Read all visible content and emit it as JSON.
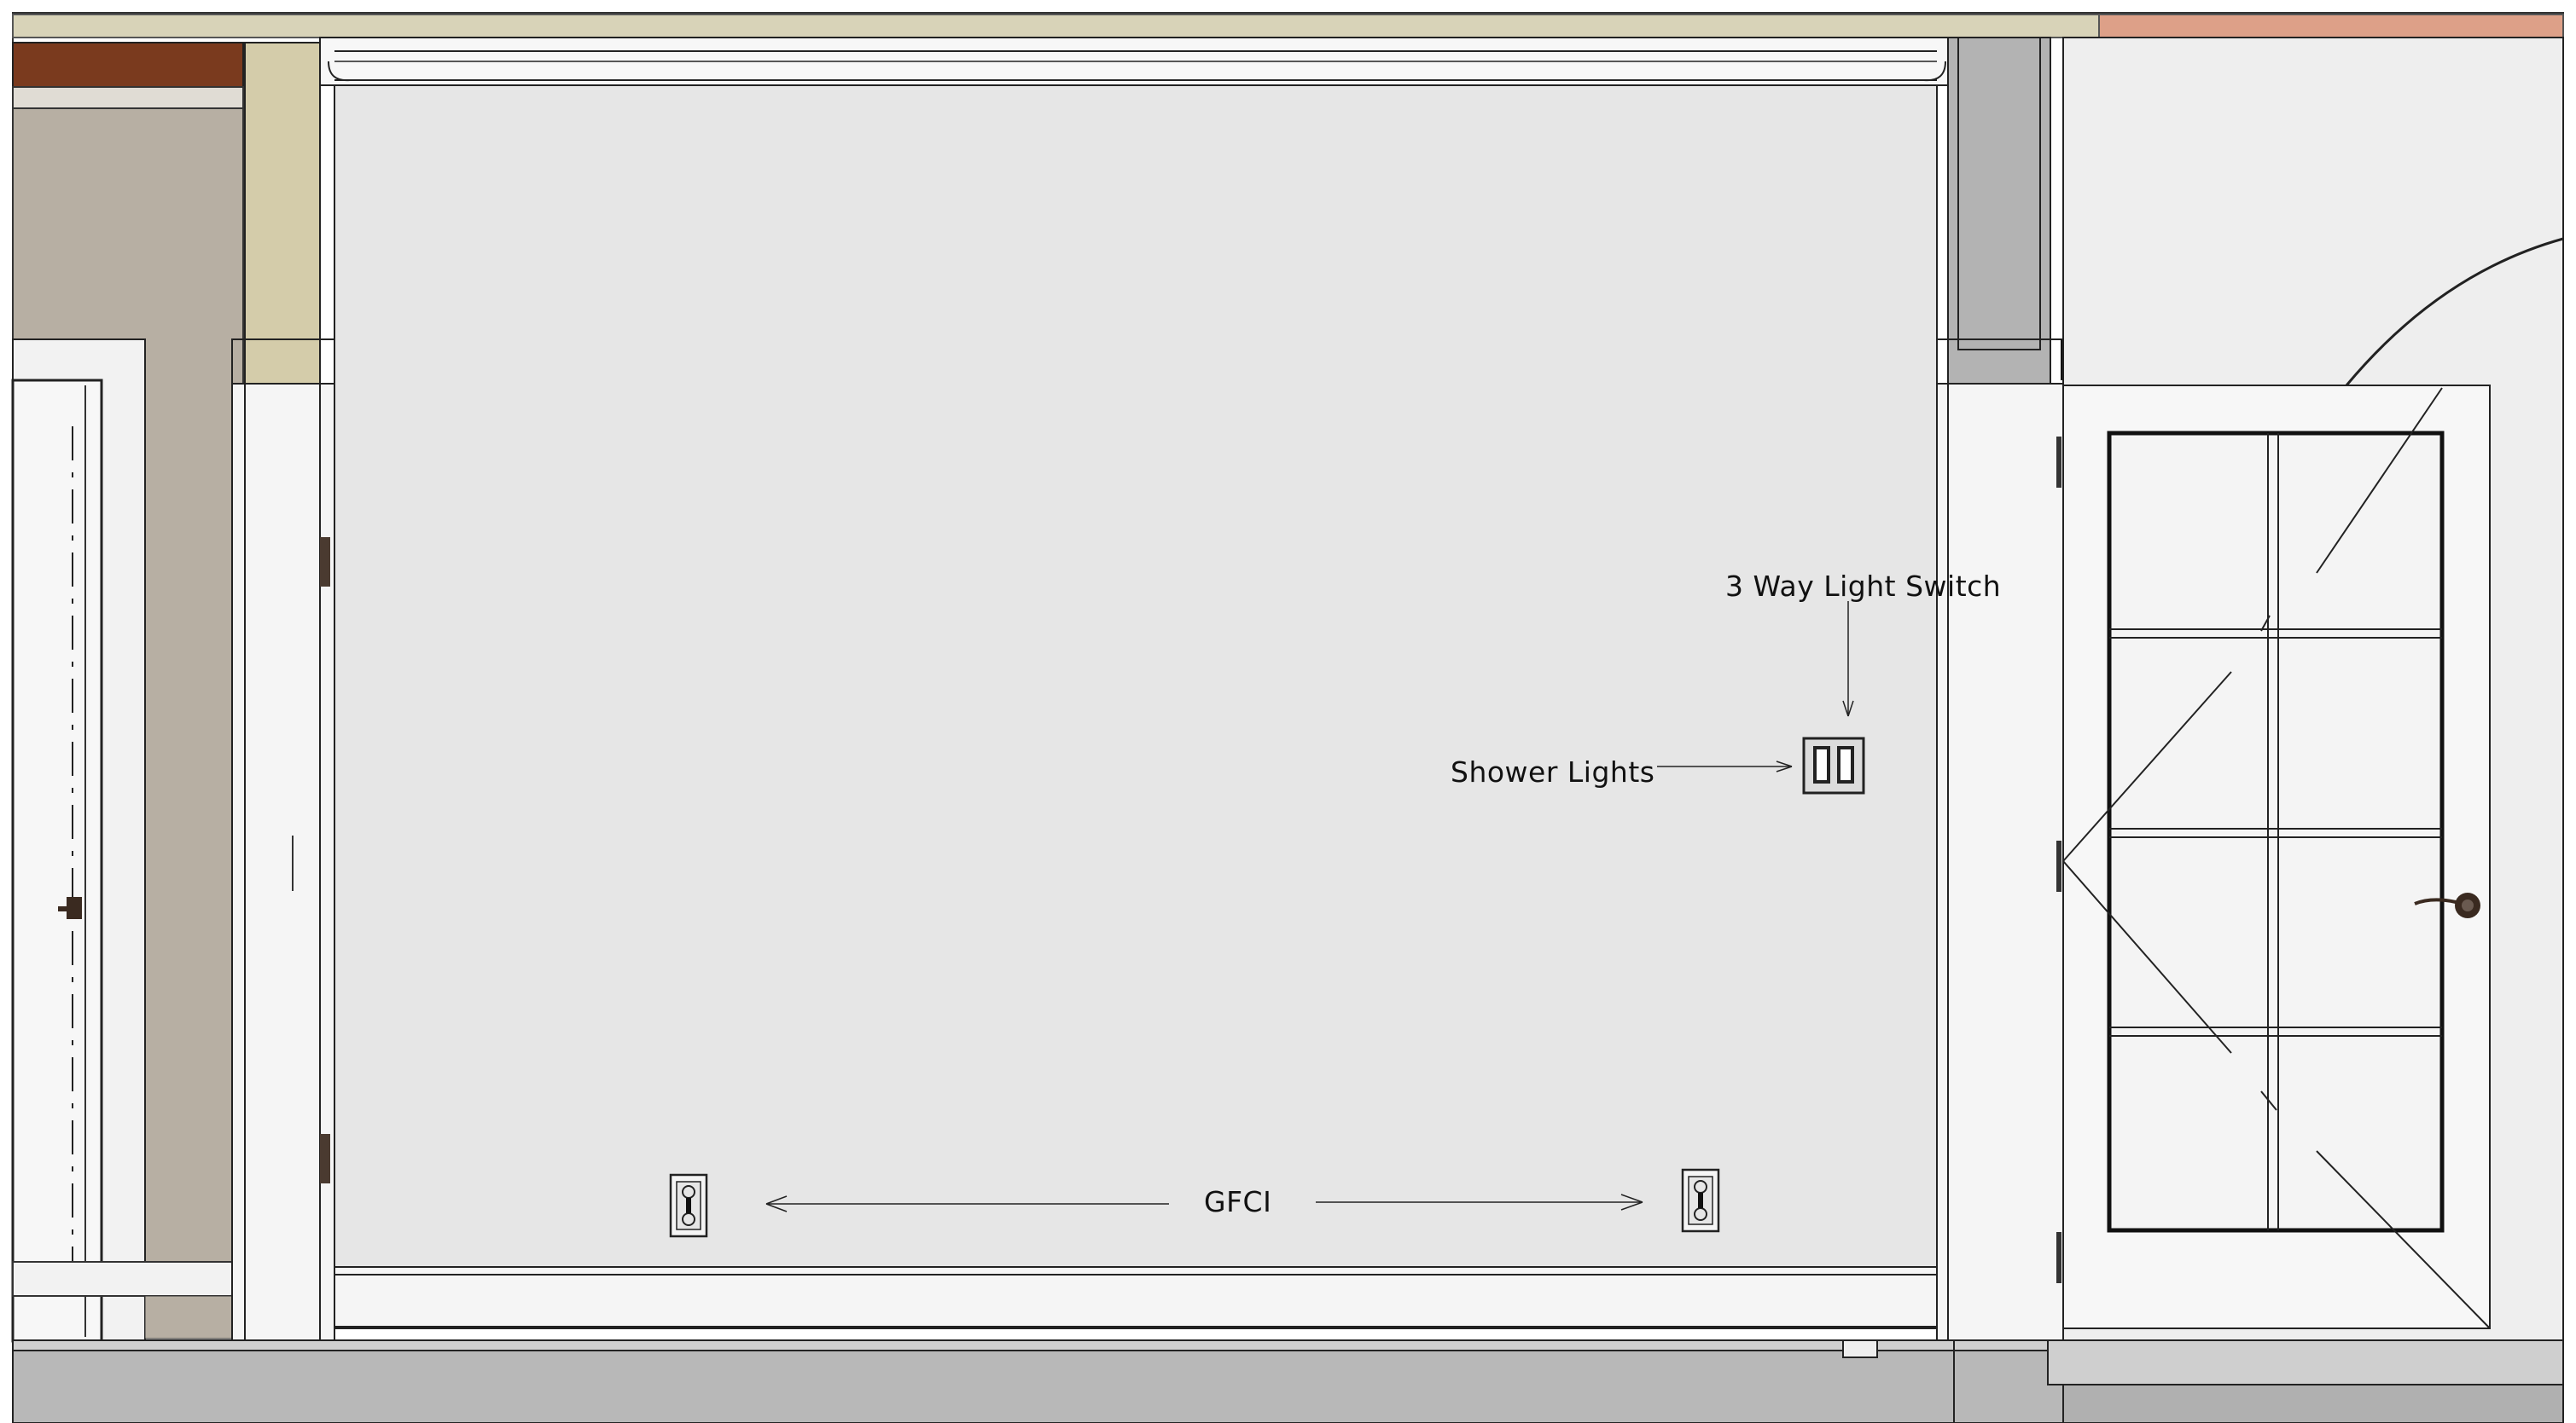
{
  "labels": {
    "switch_label": "3 Way Light Switch",
    "shower_label": "Shower Lights",
    "gfci_label": "GFCI"
  },
  "colors": {
    "wall": "#e6e6e6",
    "trim": "#f7f7f7",
    "line": "#1a1a1a",
    "ceiling_beige": "#d8d3b8",
    "ceiling_salmon": "#dda088",
    "post_beige": "#d4ccaa",
    "left_wall_taupe": "#b7afa3",
    "left_wood": "#7a3a1e",
    "floor_gray": "#b8b8b8",
    "column_gray": "#b3b3b3"
  },
  "symbols": {
    "switch": "double-switch-symbol",
    "outlet": "duplex-outlet-symbol",
    "door_handle": "door-handle-icon"
  }
}
